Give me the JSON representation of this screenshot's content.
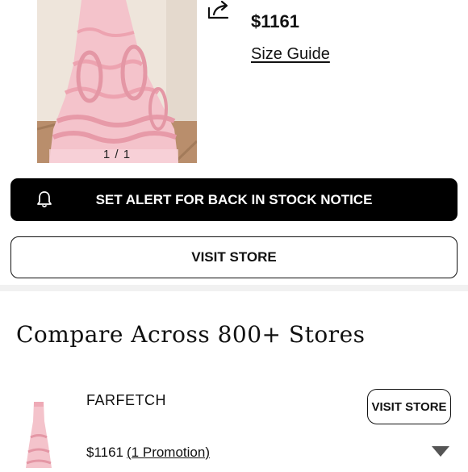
{
  "product": {
    "pager": "1 / 1",
    "price": "$1161",
    "size_guide": "Size Guide",
    "image_icon": "pink-ruffled-gown-photo",
    "share_icon": "share-icon"
  },
  "actions": {
    "alert_label": "SET ALERT FOR BACK IN STOCK NOTICE",
    "alert_icon": "bell-icon",
    "visit_store_label": "VISIT STORE"
  },
  "compare": {
    "title": "Compare Across 800+ Stores",
    "offers": [
      {
        "store": "FARFETCH",
        "visit_label": "VISIT STORE",
        "price": "$1161",
        "promotion": "(1 Promotion)",
        "expand_icon": "triangle-down-icon"
      }
    ]
  },
  "colors": {
    "primary_button_bg": "#000000",
    "text": "#111111",
    "divider": "#f1f1f1",
    "gown_pink": "#f2b8c2"
  }
}
